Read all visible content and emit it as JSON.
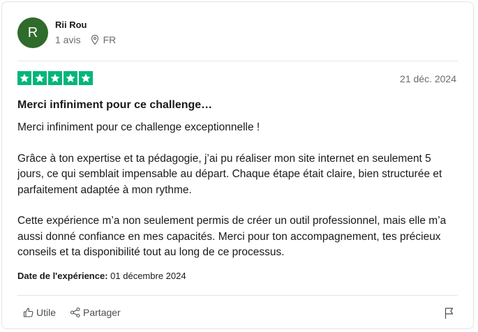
{
  "reviewer": {
    "initial": "R",
    "name": "Rii Rou",
    "reviews_count": "1 avis",
    "country": "FR",
    "avatar_color": "#2f6b2a"
  },
  "review": {
    "rating": 5,
    "star_color": "#00b67a",
    "date": "21 déc. 2024",
    "title": "Merci infiniment pour ce challenge…",
    "paragraphs": [
      "Merci infiniment pour ce challenge exceptionnelle !",
      "Grâce à ton expertise et ta pédagogie, j’ai pu réaliser mon site internet en seulement 5 jours, ce qui semblait impensable au départ. Chaque étape était claire, bien structurée et parfaitement adaptée à mon rythme.",
      "Cette expérience m’a non seulement permis de créer un outil professionnel, mais elle m’a aussi donné confiance en mes capacités. Merci pour ton accompagnement, tes précieux conseils et ta disponibilité tout au long de ce processus."
    ],
    "experience_label": "Date de l'expérience:",
    "experience_date": "01 décembre 2024"
  },
  "actions": {
    "useful_label": "Utile",
    "share_label": "Partager",
    "useful_icon": "thumbs-up-icon",
    "share_icon": "share-icon",
    "flag_icon": "flag-icon"
  }
}
